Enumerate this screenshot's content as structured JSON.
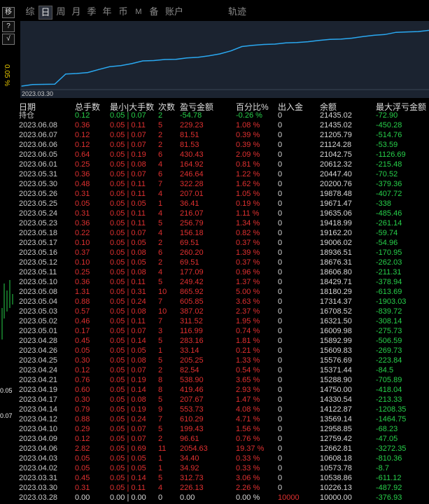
{
  "tabs": [
    "综",
    "日",
    "周",
    "月",
    "季",
    "年",
    "币",
    "M",
    "备",
    "账户",
    "轨迹"
  ],
  "active_tab": "日",
  "side": {
    "btn1": "移",
    "btn2": "?",
    "btn3": "√",
    "vertical_text": "0.05 %",
    "tick1": "0.05",
    "tick2": "0.07"
  },
  "chart": {
    "start_label": "2023.03.30",
    "chart_data": {
      "type": "line",
      "title": "",
      "x": [
        "2023.03.30",
        "2023.03.31",
        "2023.04.02",
        "2023.04.03",
        "2023.04.06",
        "2023.04.09",
        "2023.04.10",
        "2023.04.12",
        "2023.04.14",
        "2023.04.17",
        "2023.04.19",
        "2023.04.21",
        "2023.04.24",
        "2023.04.25",
        "2023.04.26",
        "2023.04.28",
        "2023.05.01",
        "2023.05.02",
        "2023.05.03",
        "2023.05.04",
        "2023.05.08",
        "2023.05.10",
        "2023.05.11",
        "2023.05.12",
        "2023.05.16",
        "2023.05.17",
        "2023.05.18",
        "2023.05.23",
        "2023.05.24",
        "2023.05.25",
        "2023.05.26",
        "2023.05.30",
        "2023.05.31",
        "2023.06.01",
        "2023.06.05",
        "2023.06.06",
        "2023.06.07",
        "2023.06.08"
      ],
      "values": [
        10226.13,
        10538.86,
        10573.78,
        10608.18,
        12662.81,
        12759.42,
        12958.85,
        13569.14,
        14122.87,
        14330.54,
        14750.0,
        15288.9,
        15371.44,
        15576.69,
        15609.83,
        15892.99,
        16009.98,
        16321.5,
        16708.52,
        17314.37,
        18180.29,
        18429.71,
        18606.8,
        18676.31,
        18936.51,
        19006.02,
        19162.2,
        19418.99,
        19635.06,
        19671.47,
        19878.48,
        20200.76,
        20447.4,
        20612.32,
        21042.75,
        21124.28,
        21205.79,
        21435.02
      ],
      "ylim": [
        9800,
        22200
      ]
    }
  },
  "table": {
    "headers": [
      "日期",
      "总手数",
      "最小|大手数",
      "次数",
      "盈亏金额",
      "百分比%",
      "出入金",
      "余额",
      "最大浮亏金额"
    ],
    "rows": [
      {
        "date": "持仓",
        "lots": "0.12",
        "minmax": "0.05 | 0.07",
        "count": "2",
        "pl": "-54.78",
        "pct": "-0.26 %",
        "io": "0",
        "bal": "21435.02",
        "dd": "-72.90",
        "pos": false
      },
      {
        "date": "2023.06.08",
        "lots": "0.36",
        "minmax": "0.05 | 0.11",
        "count": "5",
        "pl": "229.23",
        "pct": "1.08 %",
        "io": "0",
        "bal": "21435.02",
        "dd": "-450.28",
        "pos": true
      },
      {
        "date": "2023.06.07",
        "lots": "0.12",
        "minmax": "0.05 | 0.07",
        "count": "2",
        "pl": "81.51",
        "pct": "0.39 %",
        "io": "0",
        "bal": "21205.79",
        "dd": "-514.76",
        "pos": true
      },
      {
        "date": "2023.06.06",
        "lots": "0.12",
        "minmax": "0.05 | 0.07",
        "count": "2",
        "pl": "81.53",
        "pct": "0.39 %",
        "io": "0",
        "bal": "21124.28",
        "dd": "-53.59",
        "pos": true
      },
      {
        "date": "2023.06.05",
        "lots": "0.64",
        "minmax": "0.05 | 0.19",
        "count": "6",
        "pl": "430.43",
        "pct": "2.09 %",
        "io": "0",
        "bal": "21042.75",
        "dd": "-1126.69",
        "pos": true
      },
      {
        "date": "2023.06.01",
        "lots": "0.25",
        "minmax": "0.05 | 0.08",
        "count": "4",
        "pl": "164.92",
        "pct": "0.81 %",
        "io": "0",
        "bal": "20612.32",
        "dd": "-215.48",
        "pos": true
      },
      {
        "date": "2023.05.31",
        "lots": "0.36",
        "minmax": "0.05 | 0.07",
        "count": "6",
        "pl": "246.64",
        "pct": "1.22 %",
        "io": "0",
        "bal": "20447.40",
        "dd": "-70.52",
        "pos": true
      },
      {
        "date": "2023.05.30",
        "lots": "0.48",
        "minmax": "0.05 | 0.11",
        "count": "7",
        "pl": "322.28",
        "pct": "1.62 %",
        "io": "0",
        "bal": "20200.76",
        "dd": "-379.36",
        "pos": true
      },
      {
        "date": "2023.05.26",
        "lots": "0.31",
        "minmax": "0.05 | 0.11",
        "count": "4",
        "pl": "207.01",
        "pct": "1.05 %",
        "io": "0",
        "bal": "19878.48",
        "dd": "-407.72",
        "pos": true
      },
      {
        "date": "2023.05.25",
        "lots": "0.05",
        "minmax": "0.05 | 0.05",
        "count": "1",
        "pl": "36.41",
        "pct": "0.19 %",
        "io": "0",
        "bal": "19671.47",
        "dd": "-338",
        "pos": true
      },
      {
        "date": "2023.05.24",
        "lots": "0.31",
        "minmax": "0.05 | 0.11",
        "count": "4",
        "pl": "216.07",
        "pct": "1.11 %",
        "io": "0",
        "bal": "19635.06",
        "dd": "-485.46",
        "pos": true
      },
      {
        "date": "2023.05.23",
        "lots": "0.36",
        "minmax": "0.05 | 0.11",
        "count": "5",
        "pl": "256.79",
        "pct": "1.34 %",
        "io": "0",
        "bal": "19418.99",
        "dd": "-261.14",
        "pos": true
      },
      {
        "date": "2023.05.18",
        "lots": "0.22",
        "minmax": "0.05 | 0.07",
        "count": "4",
        "pl": "156.18",
        "pct": "0.82 %",
        "io": "0",
        "bal": "19162.20",
        "dd": "-59.74",
        "pos": true
      },
      {
        "date": "2023.05.17",
        "lots": "0.10",
        "minmax": "0.05 | 0.05",
        "count": "2",
        "pl": "69.51",
        "pct": "0.37 %",
        "io": "0",
        "bal": "19006.02",
        "dd": "-54.96",
        "pos": true
      },
      {
        "date": "2023.05.16",
        "lots": "0.37",
        "minmax": "0.05 | 0.08",
        "count": "6",
        "pl": "260.20",
        "pct": "1.39 %",
        "io": "0",
        "bal": "18936.51",
        "dd": "-170.95",
        "pos": true
      },
      {
        "date": "2023.05.12",
        "lots": "0.10",
        "minmax": "0.05 | 0.05",
        "count": "2",
        "pl": "69.51",
        "pct": "0.37 %",
        "io": "0",
        "bal": "18676.31",
        "dd": "-262.03",
        "pos": true
      },
      {
        "date": "2023.05.11",
        "lots": "0.25",
        "minmax": "0.05 | 0.08",
        "count": "4",
        "pl": "177.09",
        "pct": "0.96 %",
        "io": "0",
        "bal": "18606.80",
        "dd": "-211.31",
        "pos": true
      },
      {
        "date": "2023.05.10",
        "lots": "0.36",
        "minmax": "0.05 | 0.11",
        "count": "5",
        "pl": "249.42",
        "pct": "1.37 %",
        "io": "0",
        "bal": "18429.71",
        "dd": "-378.94",
        "pos": true
      },
      {
        "date": "2023.05.08",
        "lots": "1.31",
        "minmax": "0.05 | 0.31",
        "count": "10",
        "pl": "865.92",
        "pct": "5.00 %",
        "io": "0",
        "bal": "18180.29",
        "dd": "-613.69",
        "pos": true
      },
      {
        "date": "2023.05.04",
        "lots": "0.88",
        "minmax": "0.05 | 0.24",
        "count": "7",
        "pl": "605.85",
        "pct": "3.63 %",
        "io": "0",
        "bal": "17314.37",
        "dd": "-1903.03",
        "pos": true
      },
      {
        "date": "2023.05.03",
        "lots": "0.57",
        "minmax": "0.05 | 0.08",
        "count": "10",
        "pl": "387.02",
        "pct": "2.37 %",
        "io": "0",
        "bal": "16708.52",
        "dd": "-839.72",
        "pos": true
      },
      {
        "date": "2023.05.02",
        "lots": "0.46",
        "minmax": "0.05 | 0.11",
        "count": "7",
        "pl": "311.52",
        "pct": "1.95 %",
        "io": "0",
        "bal": "16321.50",
        "dd": "-308.14",
        "pos": true
      },
      {
        "date": "2023.05.01",
        "lots": "0.17",
        "minmax": "0.05 | 0.07",
        "count": "3",
        "pl": "116.99",
        "pct": "0.74 %",
        "io": "0",
        "bal": "16009.98",
        "dd": "-275.73",
        "pos": true
      },
      {
        "date": "2023.04.28",
        "lots": "0.45",
        "minmax": "0.05 | 0.14",
        "count": "5",
        "pl": "283.16",
        "pct": "1.81 %",
        "io": "0",
        "bal": "15892.99",
        "dd": "-506.59",
        "pos": true
      },
      {
        "date": "2023.04.26",
        "lots": "0.05",
        "minmax": "0.05 | 0.05",
        "count": "1",
        "pl": "33.14",
        "pct": "0.21 %",
        "io": "0",
        "bal": "15609.83",
        "dd": "-269.73",
        "pos": true
      },
      {
        "date": "2023.04.25",
        "lots": "0.30",
        "minmax": "0.05 | 0.08",
        "count": "5",
        "pl": "205.25",
        "pct": "1.33 %",
        "io": "0",
        "bal": "15576.69",
        "dd": "-223.84",
        "pos": true
      },
      {
        "date": "2023.04.24",
        "lots": "0.12",
        "minmax": "0.05 | 0.07",
        "count": "2",
        "pl": "82.54",
        "pct": "0.54 %",
        "io": "0",
        "bal": "15371.44",
        "dd": "-84.5",
        "pos": true
      },
      {
        "date": "2023.04.21",
        "lots": "0.76",
        "minmax": "0.05 | 0.19",
        "count": "8",
        "pl": "538.90",
        "pct": "3.65 %",
        "io": "0",
        "bal": "15288.90",
        "dd": "-705.89",
        "pos": true
      },
      {
        "date": "2023.04.19",
        "lots": "0.60",
        "minmax": "0.05 | 0.14",
        "count": "8",
        "pl": "419.46",
        "pct": "2.93 %",
        "io": "0",
        "bal": "14750.00",
        "dd": "-418.04",
        "pos": true
      },
      {
        "date": "2023.04.17",
        "lots": "0.30",
        "minmax": "0.05 | 0.08",
        "count": "5",
        "pl": "207.67",
        "pct": "1.47 %",
        "io": "0",
        "bal": "14330.54",
        "dd": "-213.33",
        "pos": true
      },
      {
        "date": "2023.04.14",
        "lots": "0.79",
        "minmax": "0.05 | 0.19",
        "count": "9",
        "pl": "553.73",
        "pct": "4.08 %",
        "io": "0",
        "bal": "14122.87",
        "dd": "-1208.35",
        "pos": true
      },
      {
        "date": "2023.04.12",
        "lots": "0.88",
        "minmax": "0.05 | 0.24",
        "count": "7",
        "pl": "610.29",
        "pct": "4.71 %",
        "io": "0",
        "bal": "13569.14",
        "dd": "-1464.75",
        "pos": true
      },
      {
        "date": "2023.04.10",
        "lots": "0.29",
        "minmax": "0.05 | 0.07",
        "count": "5",
        "pl": "199.43",
        "pct": "1.56 %",
        "io": "0",
        "bal": "12958.85",
        "dd": "-68.23",
        "pos": true
      },
      {
        "date": "2023.04.09",
        "lots": "0.12",
        "minmax": "0.05 | 0.07",
        "count": "2",
        "pl": "96.61",
        "pct": "0.76 %",
        "io": "0",
        "bal": "12759.42",
        "dd": "-47.05",
        "pos": true
      },
      {
        "date": "2023.04.06",
        "lots": "2.82",
        "minmax": "0.05 | 0.69",
        "count": "11",
        "pl": "2054.63",
        "pct": "19.37 %",
        "io": "0",
        "bal": "12662.81",
        "dd": "-3272.35",
        "pos": true
      },
      {
        "date": "2023.04.03",
        "lots": "0.05",
        "minmax": "0.05 | 0.05",
        "count": "1",
        "pl": "34.40",
        "pct": "0.33 %",
        "io": "0",
        "bal": "10608.18",
        "dd": "-810.36",
        "pos": true
      },
      {
        "date": "2023.04.02",
        "lots": "0.05",
        "minmax": "0.05 | 0.05",
        "count": "1",
        "pl": "34.92",
        "pct": "0.33 %",
        "io": "0",
        "bal": "10573.78",
        "dd": "-8.7",
        "pos": true
      },
      {
        "date": "2023.03.31",
        "lots": "0.45",
        "minmax": "0.05 | 0.14",
        "count": "5",
        "pl": "312.73",
        "pct": "3.06 %",
        "io": "0",
        "bal": "10538.86",
        "dd": "-611.12",
        "pos": true
      },
      {
        "date": "2023.03.30",
        "lots": "0.31",
        "minmax": "0.05 | 0.11",
        "count": "4",
        "pl": "226.13",
        "pct": "2.26 %",
        "io": "0",
        "bal": "10226.13",
        "dd": "-487.92",
        "pos": true
      },
      {
        "date": "2023.03.28",
        "lots": "0.00",
        "minmax": "0.00 | 0.00",
        "count": "0",
        "pl": "0.00",
        "pct": "0.00 %",
        "io": "10000",
        "bal": "10000.00",
        "dd": "-376.93",
        "pos": null
      }
    ]
  },
  "colors": {
    "positive": "#e03030",
    "negative": "#27d04a",
    "neutral": "#d8d8d8",
    "line": "#2aa8f0",
    "chart_bg": "#1b2330"
  }
}
